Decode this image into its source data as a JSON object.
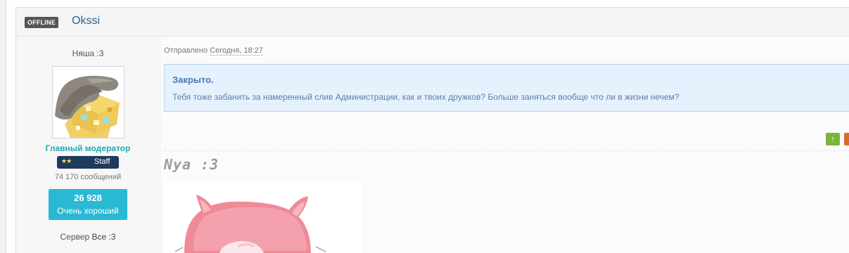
{
  "post": {
    "status_badge": "OFFLINE",
    "username": "Okssi"
  },
  "user": {
    "custom_title": "Няша :3",
    "avatar_icon": "minecraft-block-hand-avatar",
    "rank_title": "Главный модератор",
    "staff_badge": {
      "stars": "★★",
      "label": "Staff"
    },
    "message_count": "74 170 сообщений",
    "reputation": {
      "value": "26 928",
      "label": "Очень хороший"
    },
    "server_label": "Сервер",
    "server_value": "Все :3"
  },
  "message": {
    "posted_label": "Отправлено",
    "posted_date": "Сегодня, 18:27",
    "notice_title": "Закрыто.",
    "notice_text": "Тебя тоже забанить за намеренный слив Администрации, как и твоих дружков? Больше заняться вообще что ли в жизни нечем?"
  },
  "signature": {
    "text": "Nya :3",
    "image_icon": "pink-cat-image"
  },
  "actions": {
    "up_icon": "↑"
  },
  "colors": {
    "accent_teal": "#2ab9d3",
    "rank_teal": "#23a8b4",
    "notice_bg": "#e5f1fc",
    "notice_text": "#5c7fb0",
    "username_blue": "#2f5f8a"
  }
}
